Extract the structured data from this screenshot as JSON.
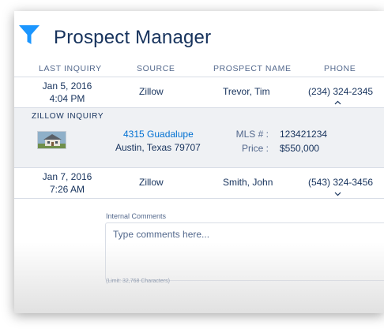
{
  "app": {
    "title": "Prospect Manager",
    "icon": "filter-funnel-icon",
    "accent": "#1b96ff"
  },
  "columns": [
    "LAST INQUIRY",
    "SOURCE",
    "PROSPECT NAME",
    "PHONE"
  ],
  "rows": [
    {
      "date": "Jan 5, 2016",
      "time": "4:04 PM",
      "source": "Zillow",
      "name": "Trevor, Tim",
      "phone": "(234) 324-2345",
      "chevron": "chevron-up-icon"
    },
    {
      "date": "Jan 7, 2016",
      "time": "7:26 AM",
      "source": "Zillow",
      "name": "Smith, John",
      "phone": "(543) 324-3456",
      "chevron": "chevron-down-icon"
    }
  ],
  "detail": {
    "title": "ZILLOW INQUIRY",
    "address_link": "4315 Guadalupe",
    "address_city": "Austin, Texas 79707",
    "mls_label": "MLS # :",
    "mls_value": "123421234",
    "price_label": "Price :",
    "price_value": "$550,000"
  },
  "comments": {
    "label": "Internal Comments",
    "placeholder": "Type comments here...",
    "limit": "(Limit: 32,768 Characters)"
  }
}
